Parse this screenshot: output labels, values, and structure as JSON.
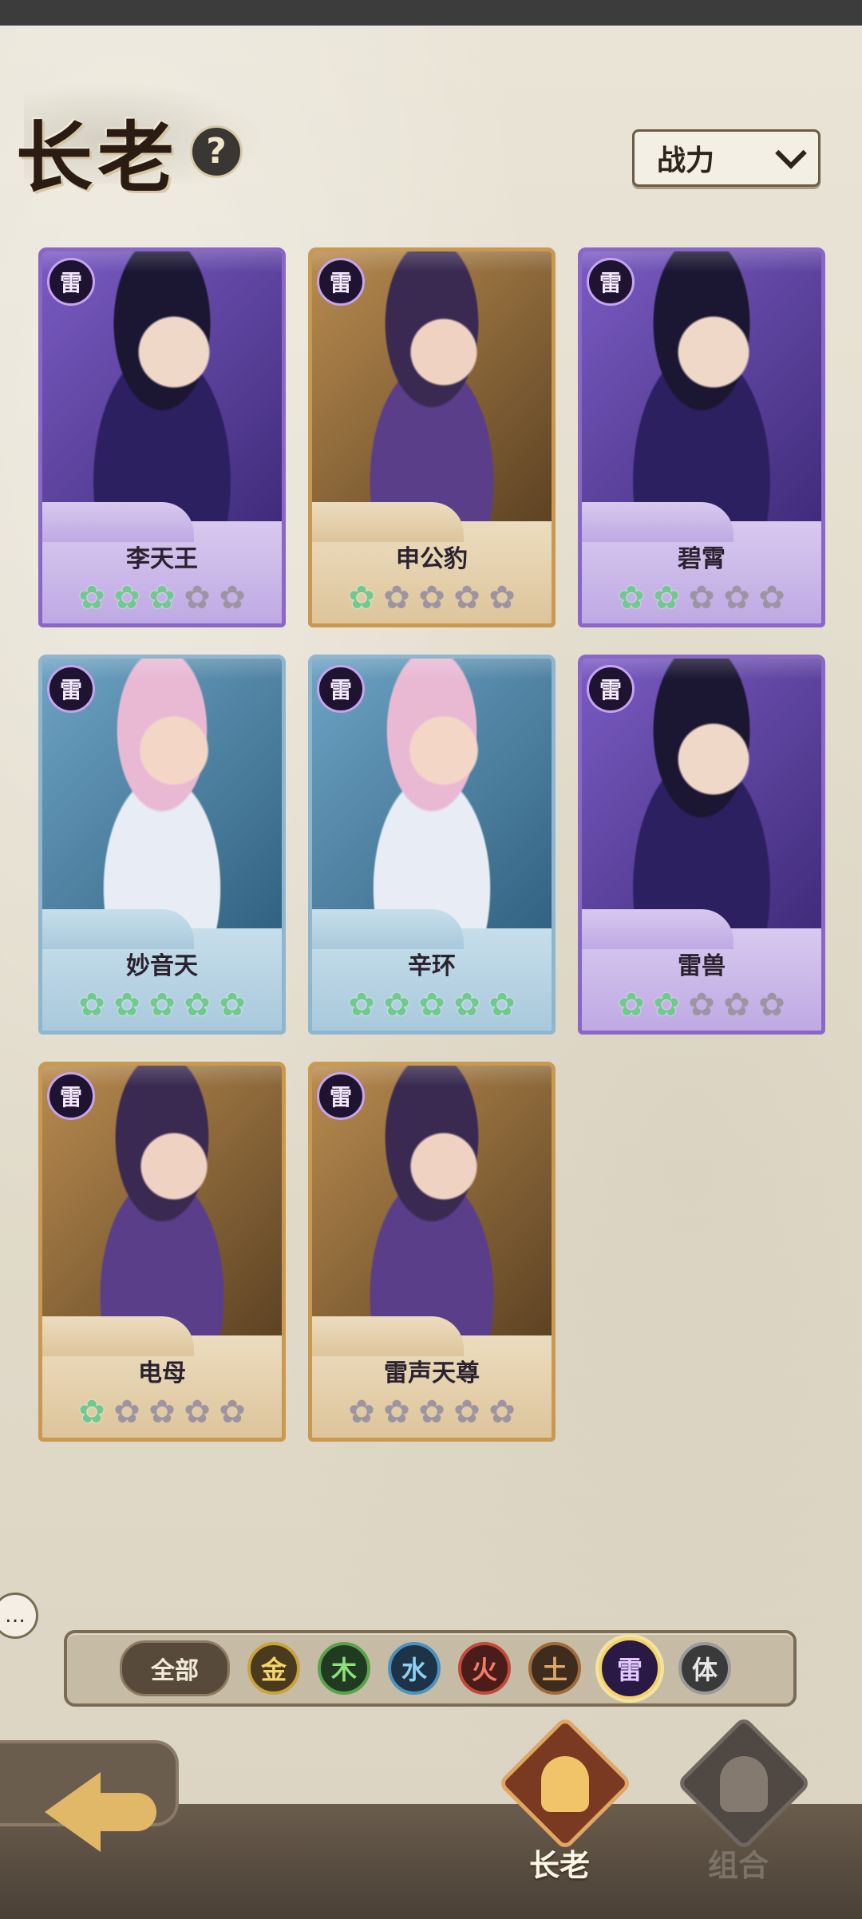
{
  "page": {
    "title": "长老",
    "help_glyph": "?"
  },
  "sort": {
    "label": "战力"
  },
  "heroes": [
    {
      "name": "李天王",
      "element": "雷",
      "theme": "purple",
      "stars": 3
    },
    {
      "name": "申公豹",
      "element": "雷",
      "theme": "gold",
      "stars": 1
    },
    {
      "name": "碧霄",
      "element": "雷",
      "theme": "purple",
      "stars": 2
    },
    {
      "name": "妙音天",
      "element": "雷",
      "theme": "blue",
      "stars": 5
    },
    {
      "name": "辛环",
      "element": "雷",
      "theme": "blue",
      "stars": 5
    },
    {
      "name": "雷兽",
      "element": "雷",
      "theme": "purple",
      "stars": 2
    },
    {
      "name": "电母",
      "element": "雷",
      "theme": "gold",
      "stars": 1
    },
    {
      "name": "雷声天尊",
      "element": "雷",
      "theme": "gold",
      "stars": 0
    }
  ],
  "star_max": 5,
  "filters": {
    "all_label": "全部",
    "elements": [
      {
        "label": "金",
        "key": "metal"
      },
      {
        "label": "木",
        "key": "wood"
      },
      {
        "label": "水",
        "key": "water"
      },
      {
        "label": "火",
        "key": "fire"
      },
      {
        "label": "土",
        "key": "earth"
      },
      {
        "label": "雷",
        "key": "thunder",
        "selected": true
      },
      {
        "label": "体",
        "key": "body"
      }
    ]
  },
  "chat_glyph": "…",
  "nav": {
    "tab_elders": "长老",
    "tab_combo": "组合"
  },
  "colors": {
    "accent_star": "#71c98f",
    "selected_ring": "#f5d36b"
  }
}
